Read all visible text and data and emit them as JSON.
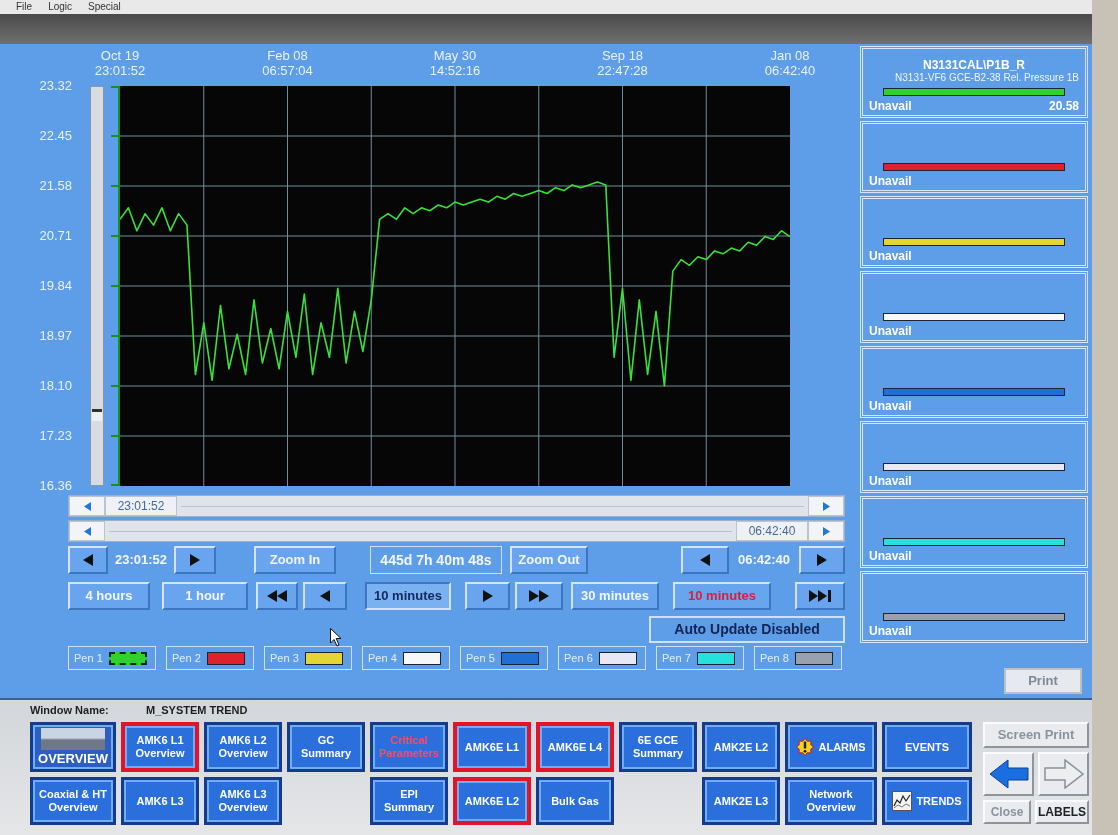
{
  "menu": [
    "File",
    "Logic",
    "Special"
  ],
  "trend": {
    "chart_data": {
      "type": "line",
      "grid": true,
      "categories": [
        "Oct 19 23:01:52",
        null,
        null,
        null,
        null,
        null,
        null,
        null,
        null,
        null,
        null,
        null,
        null,
        null,
        null,
        null,
        null,
        null,
        null,
        null,
        "Feb 08 06:57:04",
        null,
        null,
        null,
        null,
        null,
        null,
        null,
        null,
        null,
        null,
        null,
        null,
        null,
        null,
        null,
        null,
        null,
        null,
        null,
        "May 30 14:52:16",
        null,
        null,
        null,
        null,
        null,
        null,
        null,
        null,
        null,
        null,
        null,
        null,
        null,
        null,
        null,
        null,
        null,
        null,
        null,
        "Sep 18 22:47:28",
        null,
        null,
        null,
        null,
        null,
        null,
        null,
        null,
        null,
        null,
        null,
        null,
        null,
        null,
        null,
        null,
        null,
        null,
        null,
        "Jan 08 06:42:40"
      ],
      "series": [
        {
          "color": "#3be03b",
          "values": [
            21.0,
            21.2,
            20.8,
            21.1,
            20.9,
            21.2,
            20.8,
            21.1,
            20.9,
            18.3,
            19.2,
            18.2,
            19.5,
            18.4,
            19.0,
            18.3,
            19.6,
            18.5,
            19.1,
            18.4,
            19.4,
            18.6,
            19.7,
            18.3,
            19.2,
            18.6,
            19.8,
            18.5,
            19.4,
            18.7,
            19.6,
            21.0,
            21.1,
            21.0,
            21.2,
            21.1,
            21.2,
            21.15,
            21.25,
            21.2,
            21.3,
            21.25,
            21.3,
            21.35,
            21.3,
            21.4,
            21.35,
            21.45,
            21.4,
            21.45,
            21.5,
            21.45,
            21.55,
            21.5,
            21.6,
            21.55,
            21.6,
            21.65,
            21.6,
            18.6,
            19.8,
            18.2,
            19.6,
            18.3,
            19.4,
            18.1,
            20.1,
            20.3,
            20.2,
            20.35,
            20.3,
            20.45,
            20.4,
            20.5,
            20.45,
            20.6,
            20.55,
            20.7,
            20.65,
            20.8,
            20.7
          ]
        }
      ],
      "ylim": [
        16.36,
        23.32
      ],
      "yticks": [
        {
          "value": 23.32,
          "label": "23.32"
        },
        {
          "value": 22.45,
          "label": "22.45"
        },
        {
          "value": 21.58,
          "label": "21.58"
        },
        {
          "value": 20.71,
          "label": "20.71"
        },
        {
          "value": 19.84,
          "label": "19.84"
        },
        {
          "value": 18.97,
          "label": "18.97"
        },
        {
          "value": 18.1,
          "label": "18.10"
        },
        {
          "value": 17.23,
          "label": "17.23"
        },
        {
          "value": 16.36,
          "label": "16.36"
        }
      ]
    }
  },
  "scrollbars": [
    {
      "time": "23:01:52",
      "kind": "start"
    },
    {
      "time": "06:42:40",
      "kind": "end"
    }
  ],
  "controls": {
    "start_time": "23:01:52",
    "zoom_in": "Zoom In",
    "span": "445d 7h 40m 48s",
    "zoom_out": "Zoom Out",
    "end_time": "06:42:40",
    "steps": [
      {
        "label": "4 hours",
        "selected": false
      },
      {
        "label": "1 hour",
        "selected": false
      },
      {
        "label": "10 minutes",
        "selected": true
      },
      {
        "label": "30 minutes",
        "selected": false
      }
    ],
    "update_interval": "10 minutes"
  },
  "auto_update": "Auto Update Disabled",
  "pens": [
    {
      "label": "Pen 1",
      "color": "#2fd12f",
      "selected": true
    },
    {
      "label": "Pen 2",
      "color": "#e0202a",
      "selected": false
    },
    {
      "label": "Pen 3",
      "color": "#e5d534",
      "selected": false
    },
    {
      "label": "Pen 4",
      "color": "#f6f7f9",
      "selected": false
    },
    {
      "label": "Pen 5",
      "color": "#1f6fd4",
      "selected": false
    },
    {
      "label": "Pen 6",
      "color": "#e8e8f4",
      "selected": false
    },
    {
      "label": "Pen 7",
      "color": "#26e0dc",
      "selected": false
    },
    {
      "label": "Pen 8",
      "color": "#98a1ad",
      "selected": false
    }
  ],
  "legend": [
    {
      "tag": "N3131CAL\\P1B_R",
      "description": "N3131-VF6 GCE-B2-38 Rel. Pressure 1B",
      "color": "#2fd12f",
      "status": "Unavail",
      "value": "20.58"
    },
    {
      "color": "#e0202a",
      "status": "Unavail"
    },
    {
      "color": "#e5d534",
      "status": "Unavail"
    },
    {
      "color": "#f6f7f9",
      "status": "Unavail"
    },
    {
      "color": "#1f6fd4",
      "status": "Unavail"
    },
    {
      "color": "#e8e8f4",
      "status": "Unavail"
    },
    {
      "color": "#26e0dc",
      "status": "Unavail"
    },
    {
      "color": "#98a1ad",
      "status": "Unavail"
    }
  ],
  "print_button": {
    "label": "Print",
    "disabled": true
  },
  "window_name": {
    "label": "Window Name:",
    "value": "M_SYSTEM TREND"
  },
  "nav_columns": [
    {
      "top": {
        "label": "OVERVIEW",
        "kind": "overview",
        "alarm_frame": false,
        "alarm_text": false
      },
      "bottom": {
        "label": "Coaxial & HT Overview",
        "kind": "link",
        "alarm_frame": false,
        "alarm_text": false
      }
    },
    {
      "top": {
        "label": "AMK6 L1 Overview",
        "kind": "link",
        "alarm_frame": true,
        "alarm_text": false
      },
      "bottom": {
        "label": "AMK6 L3",
        "kind": "link",
        "alarm_frame": false,
        "alarm_text": false
      }
    },
    {
      "top": {
        "label": "AMK6 L2 Overview",
        "kind": "link",
        "alarm_frame": false,
        "alarm_text": false
      },
      "bottom": {
        "label": "AMK6 L3 Overview",
        "kind": "link",
        "alarm_frame": false,
        "alarm_text": false
      }
    },
    {
      "top": {
        "label": "GC Summary",
        "kind": "link",
        "alarm_frame": false,
        "alarm_text": false
      }
    },
    {
      "top": {
        "label": "Critical Parameters",
        "kind": "link",
        "alarm_frame": false,
        "alarm_text": true
      },
      "bottom": {
        "label": "EPI Summary",
        "kind": "link",
        "alarm_frame": false,
        "alarm_text": false
      }
    },
    {
      "top": {
        "label": "AMK6E L1",
        "kind": "link",
        "alarm_frame": true,
        "alarm_text": false
      },
      "bottom": {
        "label": "AMK6E L2",
        "kind": "link",
        "alarm_frame": true,
        "alarm_text": false
      }
    },
    {
      "top": {
        "label": "AMK6E L4",
        "kind": "link",
        "alarm_frame": true,
        "alarm_text": false
      },
      "bottom": {
        "label": "Bulk Gas",
        "kind": "link",
        "alarm_frame": false,
        "alarm_text": false
      }
    },
    {
      "top": {
        "label": "6E GCE Summary",
        "kind": "link",
        "alarm_frame": false,
        "alarm_text": false
      }
    },
    {
      "top": {
        "label": "AMK2E L2",
        "kind": "link",
        "alarm_frame": false,
        "alarm_text": false
      },
      "bottom": {
        "label": "AMK2E L3",
        "kind": "link",
        "alarm_frame": false,
        "alarm_text": false
      }
    },
    {
      "top": {
        "label": "ALARMS",
        "kind": "alarms",
        "alarm_frame": false,
        "alarm_text": false
      },
      "bottom": {
        "label": "Network Overview",
        "kind": "link",
        "alarm_frame": false,
        "alarm_text": false
      }
    },
    {
      "top": {
        "label": "EVENTS",
        "kind": "link",
        "alarm_frame": false,
        "alarm_text": false
      },
      "bottom": {
        "label": "TRENDS",
        "kind": "trends",
        "alarm_frame": false,
        "alarm_text": false
      }
    }
  ],
  "side_buttons": {
    "screen_print": {
      "label": "Screen Print",
      "disabled": true
    },
    "back": {
      "disabled": false
    },
    "forward": {
      "disabled": true
    },
    "close": {
      "label": "Close",
      "disabled": true
    },
    "labels": {
      "label": "LABELS",
      "disabled": false
    }
  }
}
